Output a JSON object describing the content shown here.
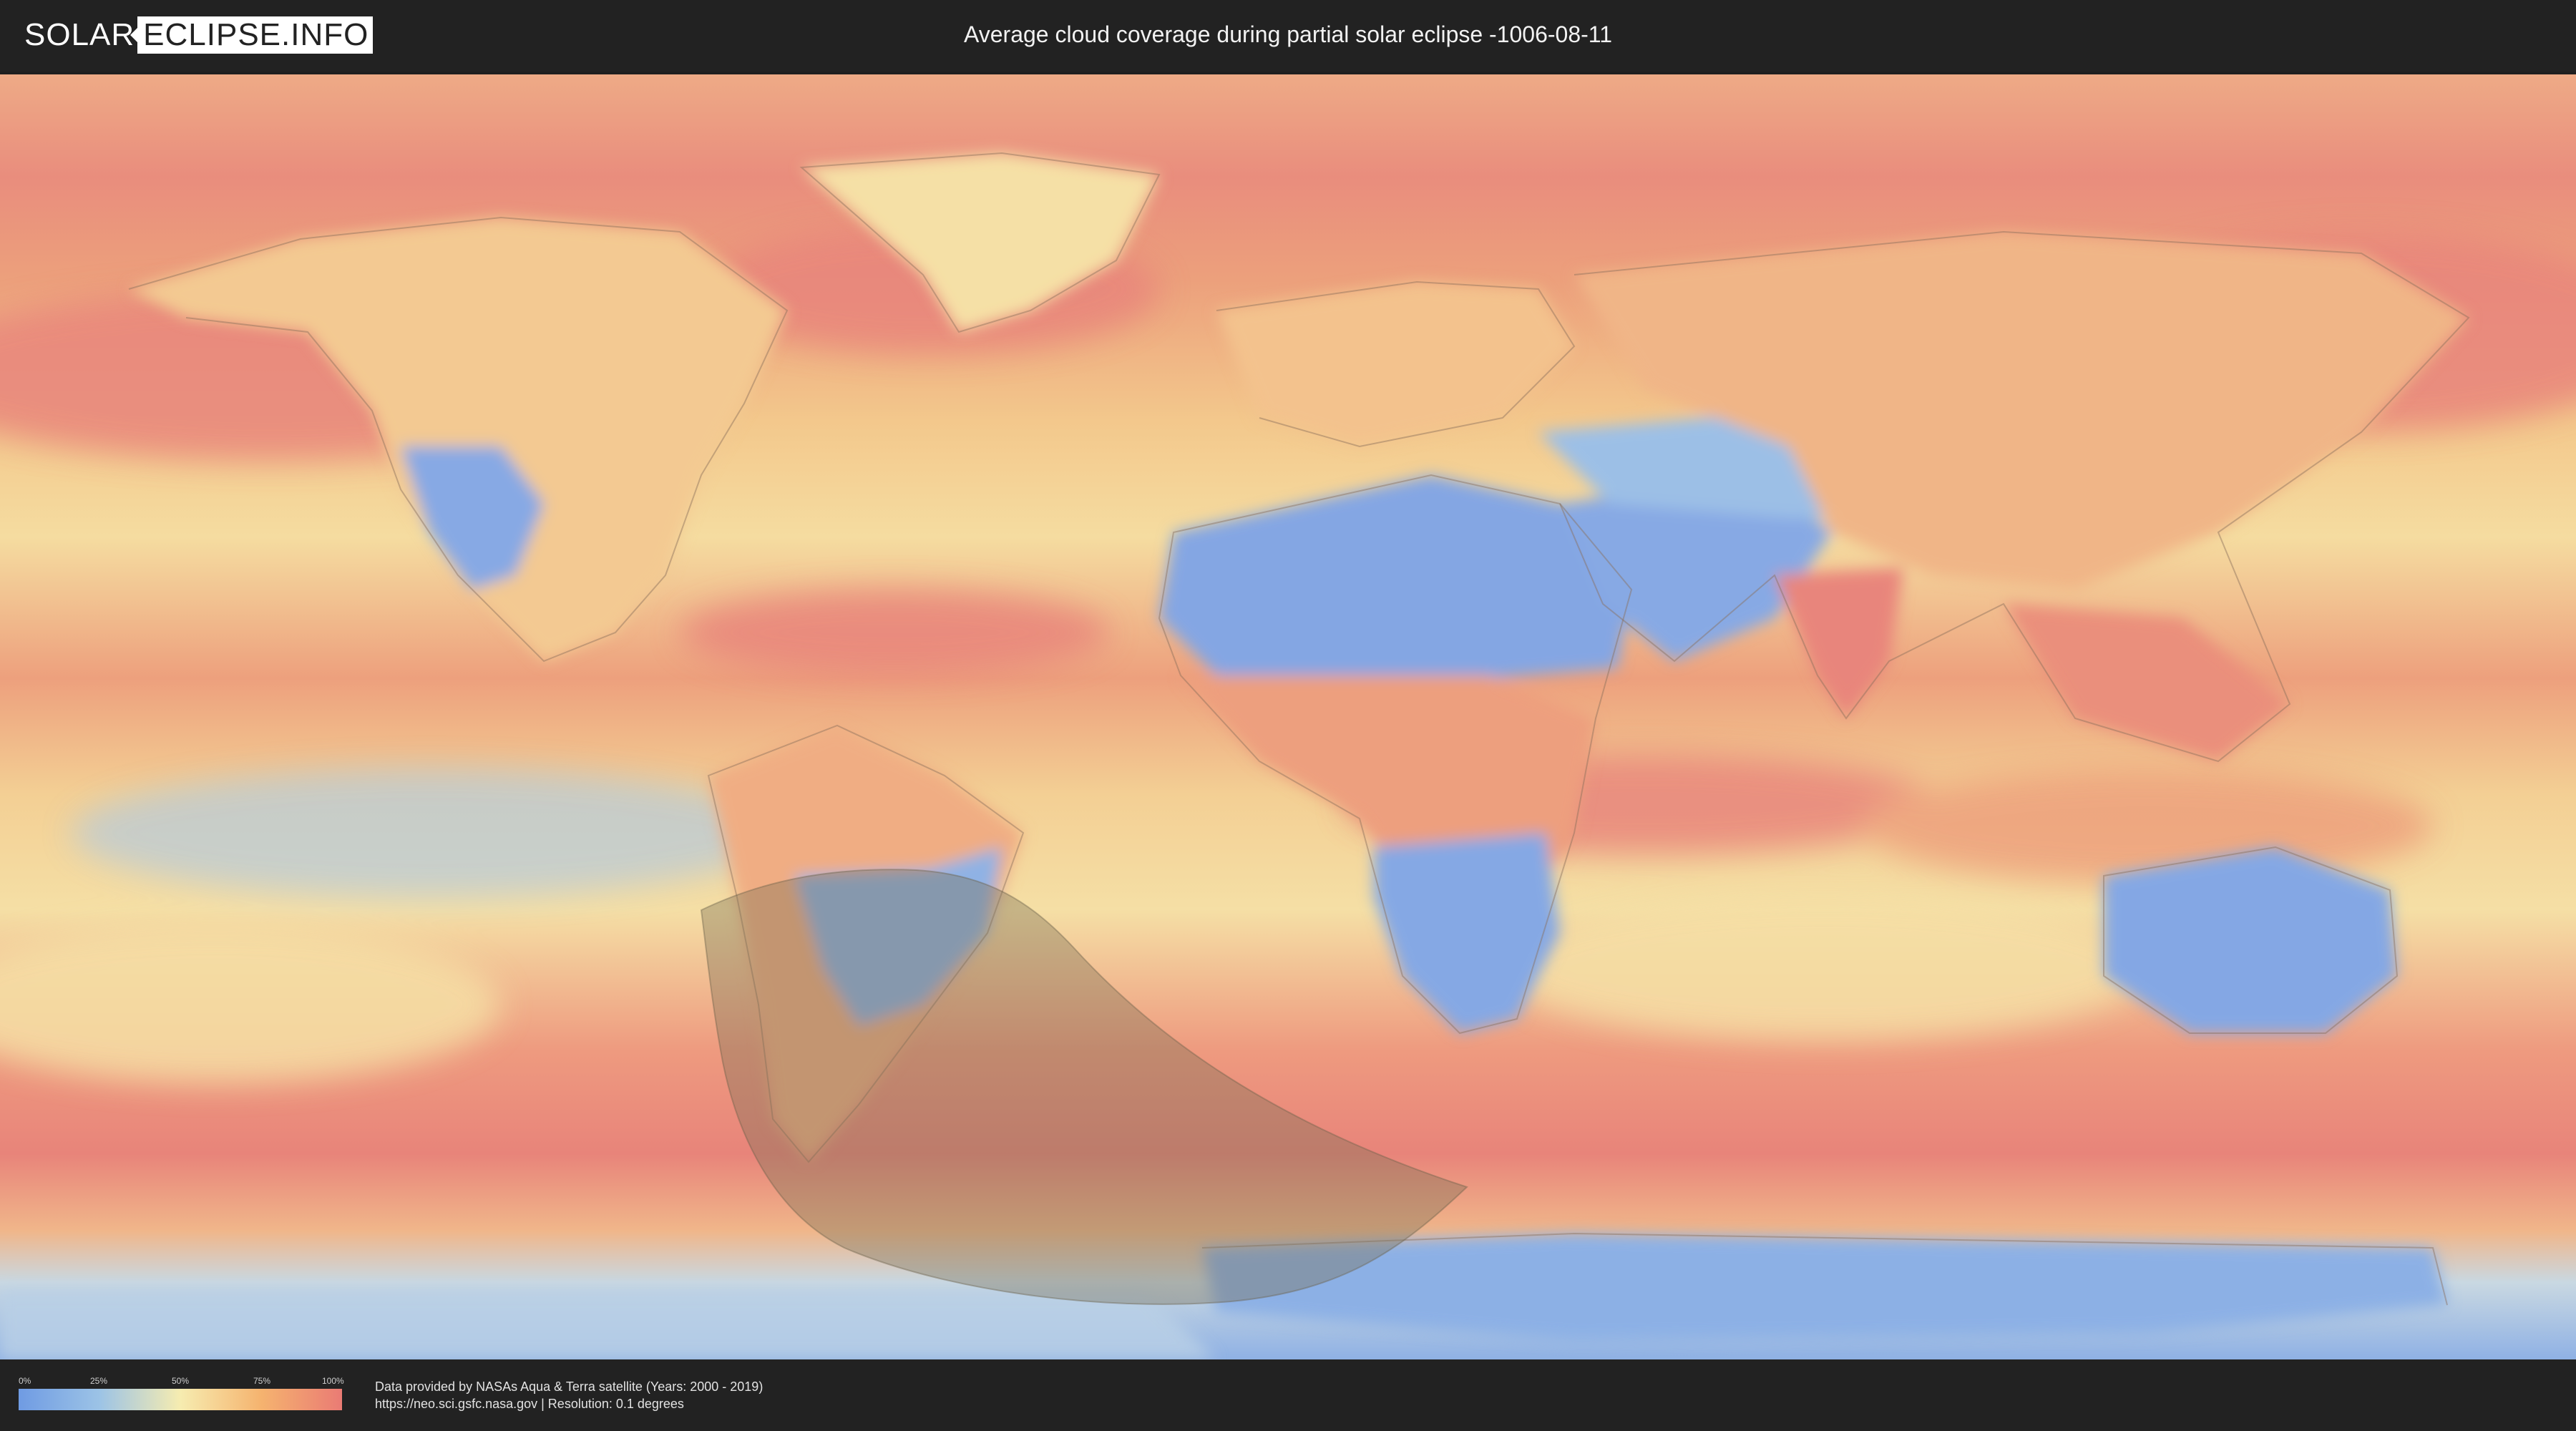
{
  "header": {
    "logo_part1": "SOLAR",
    "logo_part2": "ECLIPSE.INFO",
    "title": "Average cloud coverage during partial solar eclipse -1006-08-11"
  },
  "map": {
    "description_icon": "world-cloud-map",
    "colors": {
      "clear": "#7fa6e4",
      "low": "#a9c9e8",
      "mid": "#f3e2a6",
      "high": "#f4ae79",
      "overcast": "#e8857b",
      "eclipse_shadow": "#7a6e55"
    }
  },
  "legend": {
    "ticks": [
      "0%",
      "25%",
      "50%",
      "75%",
      "100%"
    ]
  },
  "footer": {
    "credit_line1": "Data provided by NASAs Aqua & Terra satellite (Years: 2000 - 2019)",
    "credit_line2": "https://neo.sci.gsfc.nasa.gov | Resolution: 0.1 degrees"
  }
}
